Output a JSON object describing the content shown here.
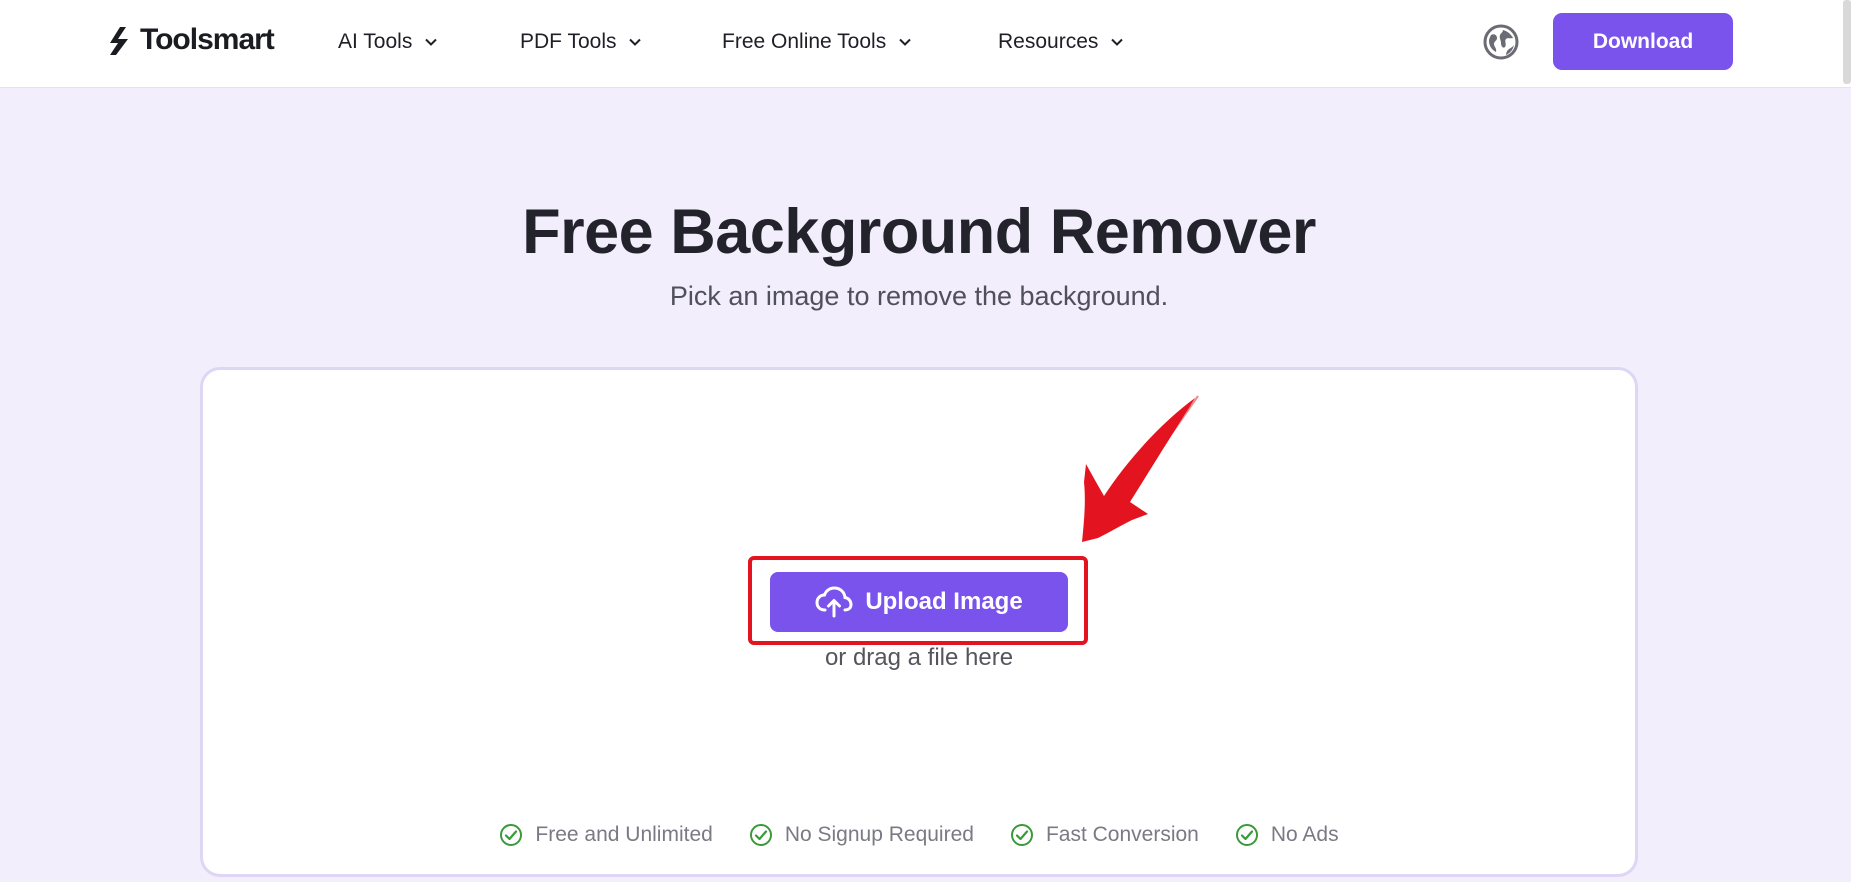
{
  "header": {
    "logo_text": "Toolsmart",
    "nav": [
      {
        "label": "AI Tools"
      },
      {
        "label": "PDF Tools"
      },
      {
        "label": "Free Online Tools"
      },
      {
        "label": "Resources"
      }
    ],
    "language_icon": "globe-icon",
    "download_label": "Download"
  },
  "hero": {
    "title": "Free Background Remover",
    "subtitle": "Pick an image to remove the background."
  },
  "upload": {
    "button_label": "Upload Image",
    "button_icon": "cloud-upload-icon",
    "drag_text": "or drag a file here"
  },
  "features": [
    {
      "label": "Free and Unlimited",
      "icon": "check-circle-icon"
    },
    {
      "label": "No Signup Required",
      "icon": "check-circle-icon"
    },
    {
      "label": "Fast Conversion",
      "icon": "check-circle-icon"
    },
    {
      "label": "No Ads",
      "icon": "check-circle-icon"
    }
  ],
  "colors": {
    "accent": "#7a52ec",
    "page_background": "#f2eefc",
    "highlight_border": "#e3141f",
    "check_green": "#3a9a3a"
  }
}
